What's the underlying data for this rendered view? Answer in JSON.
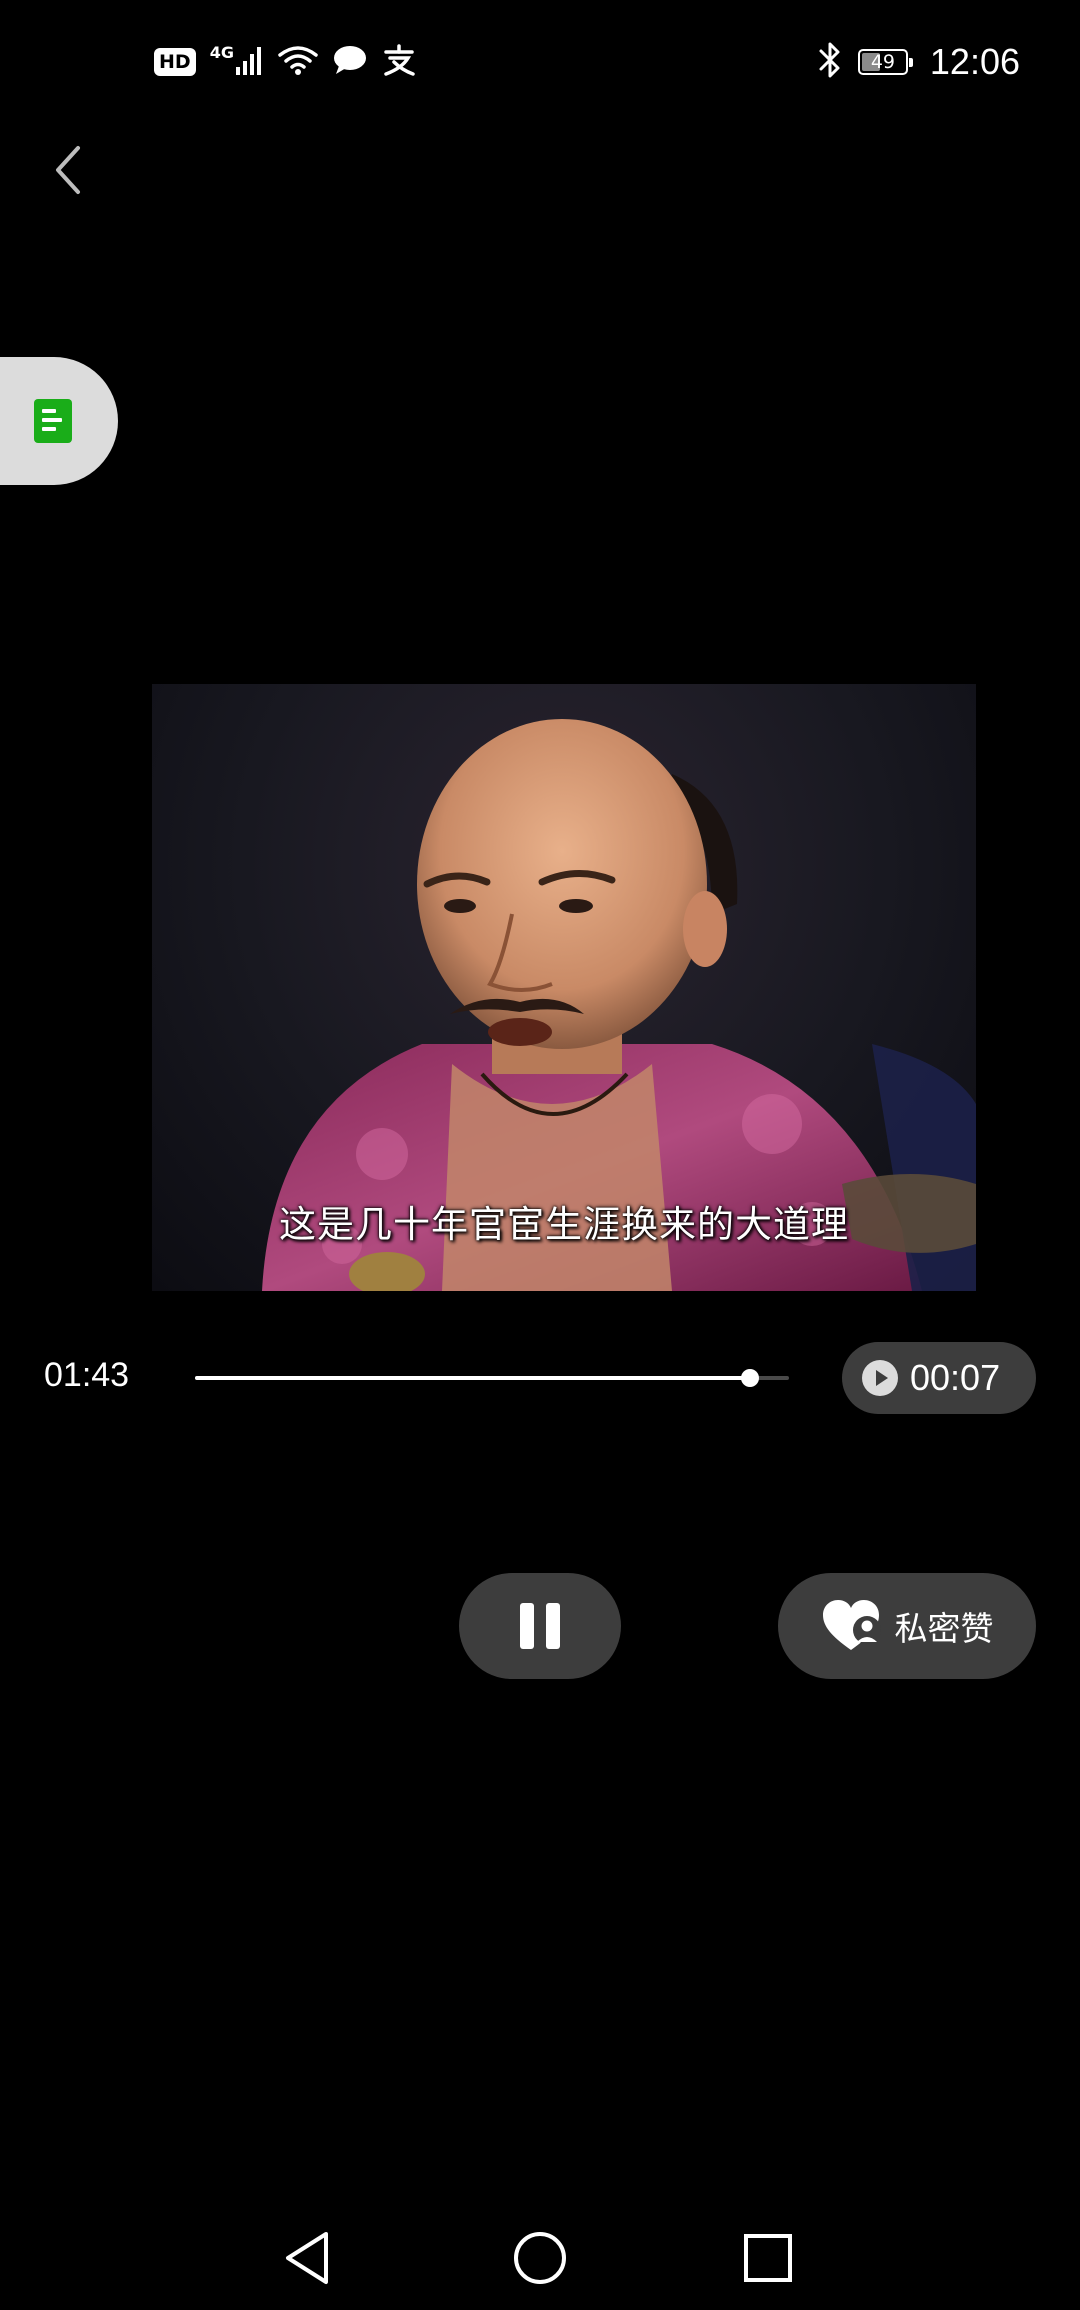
{
  "status_bar": {
    "hd_badge": "HD",
    "network_type": "4G",
    "battery_level": "49",
    "battery_fraction": 0.49,
    "time": "12:06",
    "icons": [
      "signal-icon",
      "wifi-icon",
      "message-icon",
      "alipay-icon",
      "bluetooth-icon",
      "battery-icon"
    ]
  },
  "header": {
    "back_icon": "chevron-left-icon"
  },
  "float_tab": {
    "icon": "note-icon",
    "accent_color": "#1aad19"
  },
  "video": {
    "subtitle": "这是几十年官宦生涯换来的大道理"
  },
  "player": {
    "current_time": "01:43",
    "remaining_time": "00:07",
    "progress_fraction": 0.935,
    "play_icon": "play-circle-icon"
  },
  "controls": {
    "pause_icon": "pause-icon",
    "like_label": "私密赞",
    "like_icon": "private-like-icon"
  },
  "nav": {
    "back_icon": "nav-back-icon",
    "home_icon": "nav-home-icon",
    "recents_icon": "nav-recents-icon"
  },
  "colors": {
    "background": "#000000",
    "pill": "#3d3d3d",
    "float_tab": "#dcdcdc",
    "accent_green": "#1aad19"
  }
}
